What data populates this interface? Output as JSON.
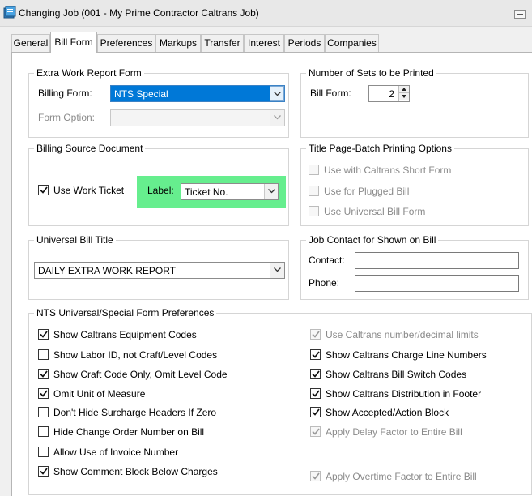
{
  "window": {
    "title": "Changing Job  (001 - My Prime Contractor Caltrans Job)"
  },
  "tabs": [
    {
      "label": "General"
    },
    {
      "label": "Bill Form"
    },
    {
      "label": "Preferences"
    },
    {
      "label": "Markups"
    },
    {
      "label": "Transfer"
    },
    {
      "label": "Interest"
    },
    {
      "label": "Periods"
    },
    {
      "label": "Companies"
    }
  ],
  "extra_work": {
    "title": "Extra Work Report Form",
    "billing_form_label": "Billing Form:",
    "billing_form_value": "NTS Special",
    "form_option_label": "Form Option:",
    "form_option_value": ""
  },
  "sets": {
    "title": "Number of Sets to be Printed",
    "bill_form_label": "Bill Form:",
    "bill_form_value": "2"
  },
  "source_doc": {
    "title": "Billing Source Document",
    "use_work_ticket_label": "Use Work Ticket",
    "use_work_ticket_checked": true,
    "label_label": "Label:",
    "label_value": "Ticket No."
  },
  "title_page": {
    "title": "Title Page-Batch Printing Options",
    "options": [
      {
        "label": "Use with Caltrans Short Form",
        "checked": false,
        "disabled": true
      },
      {
        "label": "Use for Plugged Bill",
        "checked": false,
        "disabled": true
      },
      {
        "label": "Use Universal Bill Form",
        "checked": false,
        "disabled": true
      }
    ]
  },
  "universal_title": {
    "title": "Universal Bill Title",
    "value": "DAILY EXTRA WORK REPORT"
  },
  "job_contact": {
    "title": "Job Contact for Shown on Bill",
    "contact_label": "Contact:",
    "contact_value": "",
    "phone_label": "Phone:",
    "phone_value": ""
  },
  "nts_prefs": {
    "title": "NTS Universal/Special Form Preferences",
    "left": [
      {
        "label": "Show Caltrans Equipment Codes",
        "checked": true,
        "disabled": false
      },
      {
        "label": "Show Labor ID, not Craft/Level Codes",
        "checked": false,
        "disabled": false
      },
      {
        "label": "Show Craft Code Only, Omit Level Code",
        "checked": true,
        "disabled": false
      },
      {
        "label": "Omit Unit of Measure",
        "checked": true,
        "disabled": false
      },
      {
        "label": "Don't Hide Surcharge Headers If Zero",
        "checked": false,
        "disabled": false
      },
      {
        "label": "Hide Change Order Number on Bill",
        "checked": false,
        "disabled": false
      },
      {
        "label": "Allow Use of Invoice Number",
        "checked": false,
        "disabled": false
      },
      {
        "label": "Show Comment Block Below Charges",
        "checked": true,
        "disabled": false
      }
    ],
    "right": [
      {
        "label": "Use Caltrans number/decimal limits",
        "checked": true,
        "disabled": true
      },
      {
        "label": "Show Caltrans Charge Line Numbers",
        "checked": true,
        "disabled": false
      },
      {
        "label": "Show Caltrans Bill Switch Codes",
        "checked": true,
        "disabled": false
      },
      {
        "label": "Show Caltrans Distribution in Footer",
        "checked": true,
        "disabled": false
      },
      {
        "label": "Show Accepted/Action Block",
        "checked": true,
        "disabled": false
      },
      {
        "label": "Apply Delay Factor to Entire Bill",
        "checked": true,
        "disabled": true
      },
      {
        "label": "Apply Overtime Factor to Entire Bill",
        "checked": true,
        "disabled": true
      }
    ]
  },
  "colors": {
    "highlight": "#66ee8e",
    "selection": "#0078d7"
  }
}
